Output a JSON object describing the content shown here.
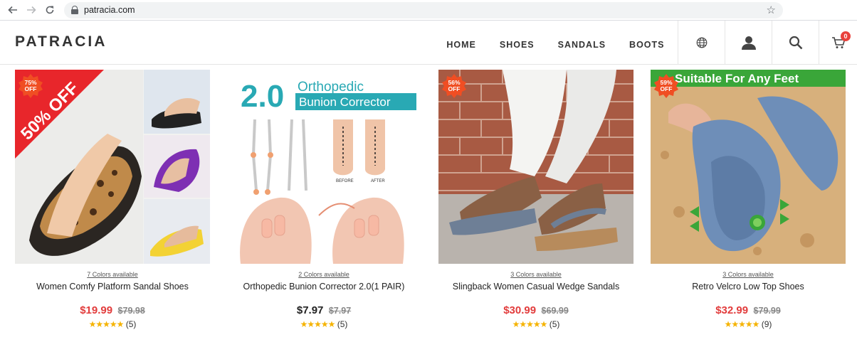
{
  "browser": {
    "url": "patracia.com"
  },
  "site": {
    "logo": "PATRACIA",
    "nav": [
      "HOME",
      "SHOES",
      "SANDALS",
      "BOOTS"
    ],
    "cart_count": "0"
  },
  "products": [
    {
      "badge": [
        "75%",
        "OFF"
      ],
      "banner": "50% OFF",
      "colors": "7 Colors available",
      "title": "Women Comfy Platform Sandal Shoes",
      "price": "$19.99",
      "old_price": "$79.98",
      "stars": "★★★★★",
      "reviews": "(5)"
    },
    {
      "headline_num": "2.0",
      "headline_a": "Orthopedic",
      "headline_b": "Bunion Corrector",
      "before": "BEFORE",
      "after": "AFTER",
      "colors": "2 Colors available",
      "title": "Orthopedic Bunion Corrector 2.0(1 PAIR)",
      "price": "$7.97",
      "old_price": "$7.97",
      "stars": "★★★★★",
      "reviews": "(5)"
    },
    {
      "badge": [
        "56%",
        "OFF"
      ],
      "colors": "3 Colors available",
      "title": "Slingback Women Casual Wedge Sandals",
      "price": "$30.99",
      "old_price": "$69.99",
      "stars": "★★★★★",
      "reviews": "(5)"
    },
    {
      "badge": [
        "59%",
        "OFF"
      ],
      "banner": "Suitable For Any Feet",
      "colors": "3 Colors available",
      "title": "Retro Velcro Low Top Shoes",
      "price": "$32.99",
      "old_price": "$79.99",
      "stars": "★★★★★",
      "reviews": "(9)"
    }
  ],
  "colors": {
    "accent_red": "#e23c3c",
    "badge_orange": "#f04e23",
    "star_gold": "#f5b301",
    "teal": "#29a9b4"
  }
}
